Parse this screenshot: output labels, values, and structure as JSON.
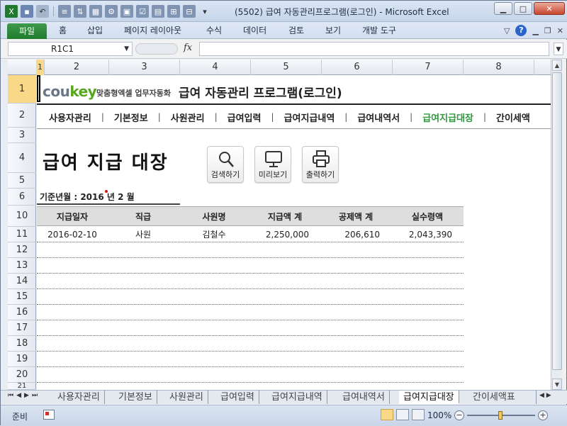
{
  "window": {
    "title": "(5502) 급여 자동관리프로그램(로그인) - Microsoft Excel"
  },
  "ribbon": {
    "tabs": [
      "파일",
      "홈",
      "삽입",
      "페이지 레이아웃",
      "수식",
      "데이터",
      "검토",
      "보기",
      "개발 도구"
    ],
    "help": "?"
  },
  "formula_bar": {
    "name_box": "R1C1",
    "fx": "fx",
    "value": ""
  },
  "columns": [
    "1",
    "2",
    "3",
    "4",
    "5",
    "6",
    "7",
    "8"
  ],
  "rows": [
    "1",
    "2",
    "3",
    "4",
    "5",
    "6",
    "10",
    "11",
    "12",
    "13",
    "14",
    "15",
    "16",
    "17",
    "18",
    "19",
    "20",
    "21"
  ],
  "header": {
    "logo_main": "cou",
    "logo_key": "key",
    "logo_sub": "맞춤형엑셀 업무자동화",
    "app_title": "급여 자동관리 프로그램(로그인)"
  },
  "nav": {
    "items": [
      "사용자관리",
      "기본정보",
      "사원관리",
      "급여입력",
      "급여지급내역",
      "급여내역서",
      "급여지급대장",
      "간이세액"
    ],
    "separator": "|",
    "active_index": 6
  },
  "page": {
    "title": "급여 지급 대장",
    "buttons": {
      "search": "검색하기",
      "preview": "미리보기",
      "print": "출력하기"
    },
    "base_date": "기준년월 : 2016 년  2 월"
  },
  "table": {
    "headers": [
      "지급일자",
      "직급",
      "사원명",
      "지급액 계",
      "공제액 계",
      "실수령액"
    ],
    "rows": [
      [
        "2016-02-10",
        "사원",
        "김철수",
        "2,250,000",
        "206,610",
        "2,043,390"
      ]
    ]
  },
  "sheet_tabs": [
    "사용자관리",
    "기본정보",
    "사원관리",
    "급여입력",
    "급여지급내역",
    "급여내역서",
    "급여지급대장",
    "간이세액표"
  ],
  "active_sheet": "급여지급대장",
  "status": {
    "ready": "준비",
    "zoom": "100%"
  }
}
